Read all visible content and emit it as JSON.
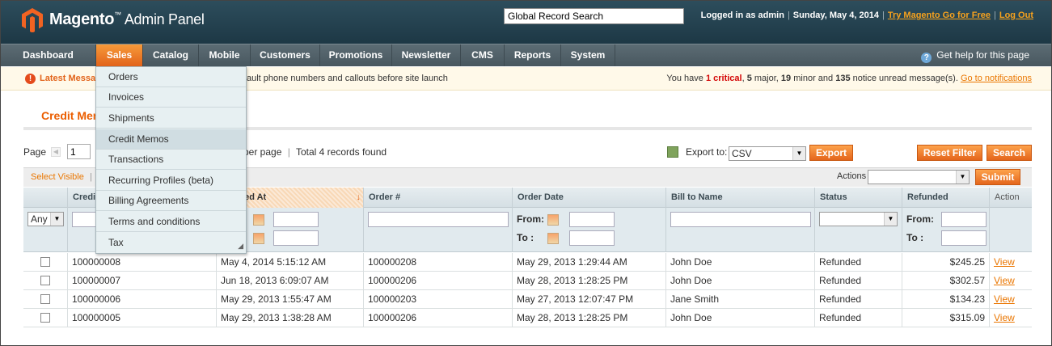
{
  "header": {
    "brand": "Magento",
    "brand_tm": "™",
    "brand_sub": "Admin Panel",
    "search_value": "Global Record Search",
    "logged_in": "Logged in as admin",
    "date": "Sunday, May 4, 2014",
    "try_link": "Try Magento Go for Free",
    "logout": "Log Out",
    "sep": "|"
  },
  "nav": {
    "items": [
      "Dashboard",
      "Sales",
      "Catalog",
      "Mobile",
      "Customers",
      "Promotions",
      "Newsletter",
      "CMS",
      "Reports",
      "System"
    ],
    "active": "Sales",
    "help": "Get help for this page"
  },
  "notice": {
    "latest": "Latest Message:",
    "message": "ault phone numbers and callouts before site launch",
    "you_have": "You have",
    "critical_count": "1 critical",
    "major": "5",
    "major_label": "major,",
    "minor": "19",
    "minor_label": "minor and",
    "notice_count": "135",
    "notice_label": "notice unread message(s).",
    "link": "Go to notifications"
  },
  "page": {
    "title": "Credit Memos"
  },
  "pager": {
    "page_label": "Page",
    "page_value": "1",
    "per_page": "per page",
    "sep": "|",
    "total": "Total 4 records found",
    "export_label": "Export to:",
    "export_format": "CSV",
    "export_button": "Export",
    "reset_filter": "Reset Filter",
    "search": "Search"
  },
  "massaction": {
    "select_visible": "Select Visible",
    "sep": "|",
    "actions_label": "Actions",
    "submit": "Submit"
  },
  "grid": {
    "columns": [
      "",
      "Credit",
      "Created At",
      "Order #",
      "Order Date",
      "Bill to Name",
      "Status",
      "Refunded",
      "Action"
    ],
    "filter": {
      "any": "Any",
      "from": "From:",
      "to": "To :"
    },
    "rows": [
      {
        "credit": "100000008",
        "created": "May 4, 2014 5:15:12 AM",
        "order": "100000208",
        "order_date": "May 29, 2013 1:29:44 AM",
        "bill_to": "John Doe",
        "status": "Refunded",
        "refunded": "$245.25",
        "action": "View"
      },
      {
        "credit": "100000007",
        "created": "Jun 18, 2013 6:09:07 AM",
        "order": "100000206",
        "order_date": "May 28, 2013 1:28:25 PM",
        "bill_to": "John Doe",
        "status": "Refunded",
        "refunded": "$302.57",
        "action": "View"
      },
      {
        "credit": "100000006",
        "created": "May 29, 2013 1:55:47 AM",
        "order": "100000203",
        "order_date": "May 27, 2013 12:07:47 PM",
        "bill_to": "Jane Smith",
        "status": "Refunded",
        "refunded": "$134.23",
        "action": "View"
      },
      {
        "credit": "100000005",
        "created": "May 29, 2013 1:38:28 AM",
        "order": "100000206",
        "order_date": "May 28, 2013 1:28:25 PM",
        "bill_to": "John Doe",
        "status": "Refunded",
        "refunded": "$315.09",
        "action": "View"
      }
    ]
  },
  "sales_menu": {
    "items": [
      "Orders",
      "Invoices",
      "Shipments",
      "Credit Memos",
      "Transactions",
      "Recurring Profiles (beta)",
      "Billing Agreements",
      "Terms and conditions",
      "Tax"
    ],
    "hovered": "Credit Memos"
  },
  "colors": {
    "accent": "#eb5e00",
    "nav_active": "#e2631a",
    "link": "#ea7601",
    "header_bg": "#1d3845"
  }
}
